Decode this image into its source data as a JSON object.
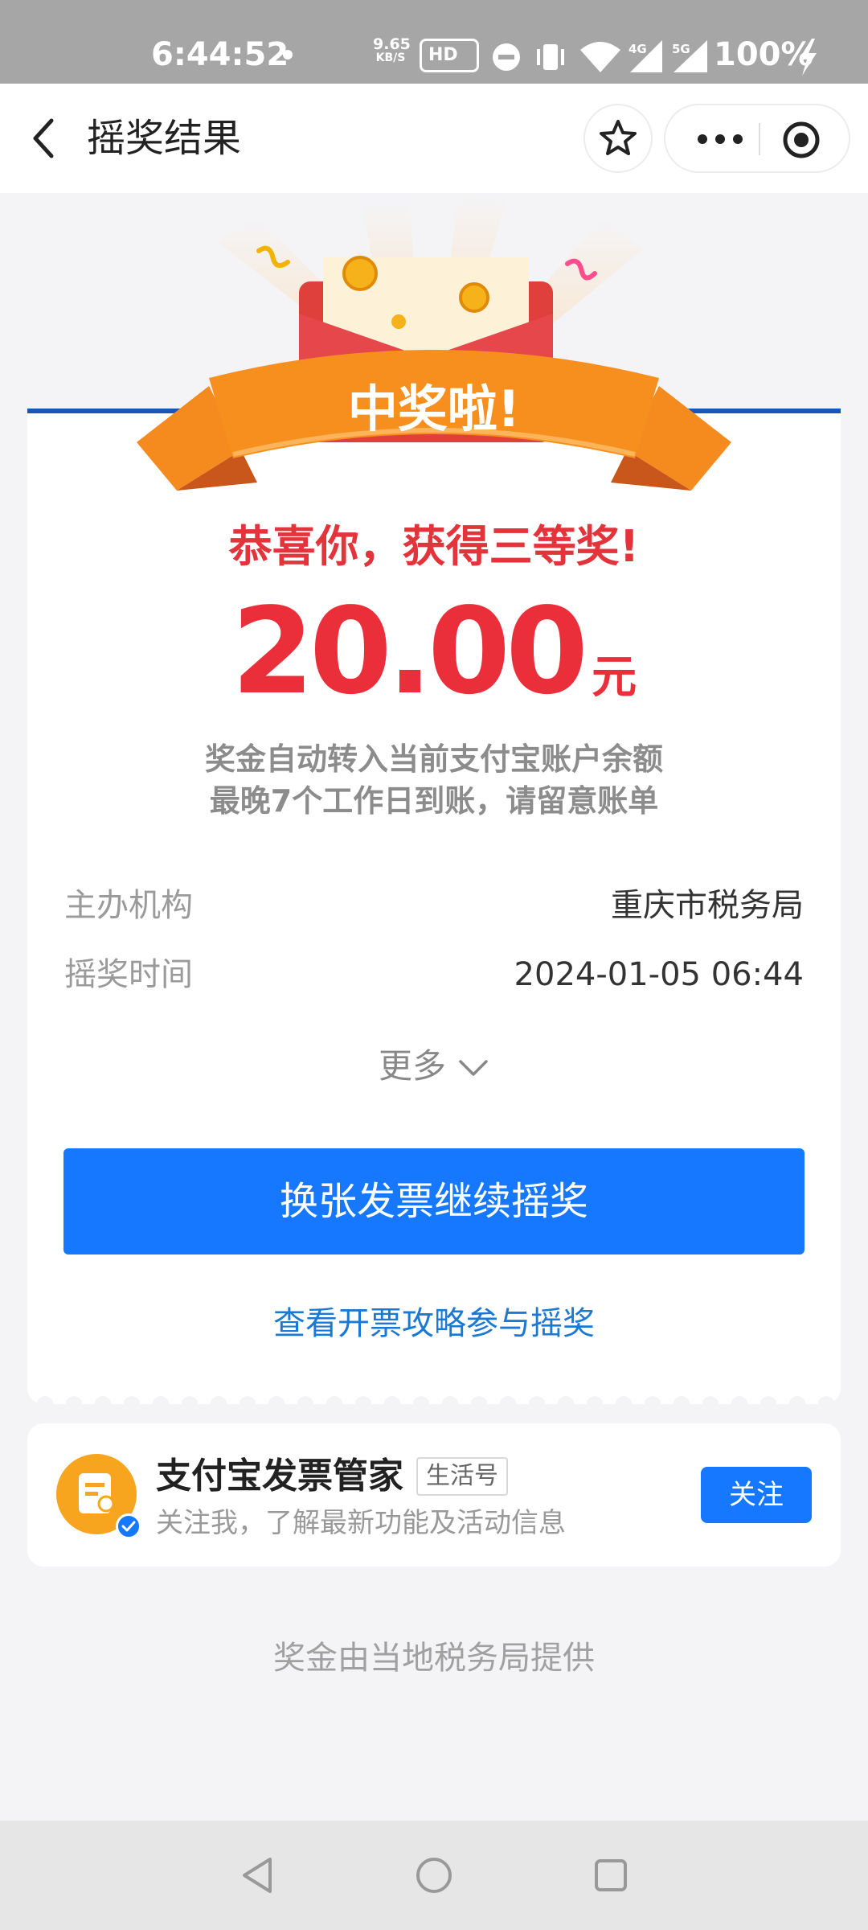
{
  "status_bar": {
    "time": "6:44:52",
    "net_speed": "9.65",
    "net_unit": "KB/S",
    "hd": "HD",
    "signal_4g": "4G",
    "signal_5g": "5G",
    "battery": "100%"
  },
  "header": {
    "title": "摇奖结果",
    "icons": [
      "back-arrow",
      "star",
      "more-dots",
      "target"
    ]
  },
  "result": {
    "banner": "中奖啦!",
    "congrats": "恭喜你，获得三等奖!",
    "amount": "20.00",
    "unit": "元",
    "note_line1": "奖金自动转入当前支付宝账户余额",
    "note_line2": "最晚7个工作日到账，请留意账单"
  },
  "info": {
    "organizer_label": "主办机构",
    "organizer_value": "重庆市税务局",
    "time_label": "摇奖时间",
    "time_value": "2024-01-05 06:44",
    "more_label": "更多"
  },
  "actions": {
    "main_button": "换张发票继续摇奖",
    "guide_link": "查看开票攻略参与摇奖"
  },
  "follow": {
    "name": "支付宝发票管家",
    "tag": "生活号",
    "desc": "关注我，了解最新功能及活动信息",
    "button": "关注"
  },
  "footer_note": "奖金由当地税务局提供",
  "colors": {
    "accent_blue": "#1677ff",
    "prize_red": "#ea2f3a",
    "ribbon_orange": "#f58a1f",
    "envelope_red": "#e0403c"
  }
}
